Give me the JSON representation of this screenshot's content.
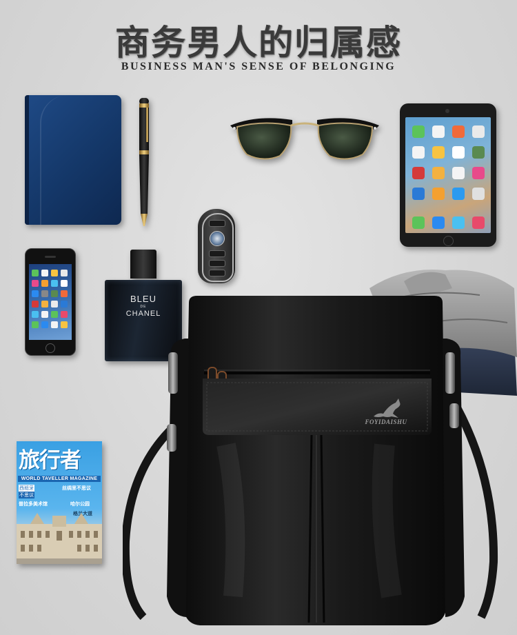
{
  "heading": {
    "title_cn": "商务男人的归属感",
    "title_en": "BUSINESS MAN'S SENSE OF BELONGING"
  },
  "perfume": {
    "line1": "BLEU",
    "line2": "DE",
    "line3": "CHANEL"
  },
  "magazine": {
    "title": "旅行者",
    "subtitle": "WORLD TAVELLER MAGAZINE",
    "tag1": "西班牙",
    "tag2": "不思议",
    "line1": "丝绸里不思议",
    "line2": "普拉多美术馆",
    "line3": "哈尔公园",
    "line4": "格兰大道"
  },
  "bag": {
    "brand": "FOYIDAISHU"
  },
  "colors": {
    "background": "#d8d8d8",
    "notebook": "#1a4178",
    "bag_leather": "#141414",
    "magazine_blue": "#3aa0e3"
  }
}
